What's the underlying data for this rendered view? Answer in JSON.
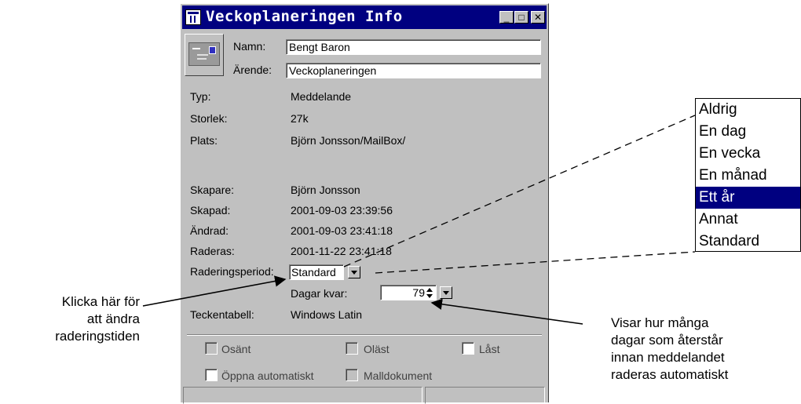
{
  "window": {
    "title": "Veckoplaneringen Info",
    "minimize_glyph": "_",
    "maximize_glyph": "□",
    "close_glyph": "✕"
  },
  "header": {
    "icon": "envelope-message-icon",
    "name_label": "Namn:",
    "name_value": "Bengt Baron",
    "subject_label": "Ärende:",
    "subject_value": "Veckoplaneringen"
  },
  "props": {
    "type_label": "Typ:",
    "type_value": "Meddelande",
    "size_label": "Storlek:",
    "size_value": "27k",
    "location_label": "Plats:",
    "location_value": "Björn Jonsson/MailBox/",
    "creator_label": "Skapare:",
    "creator_value": "Björn Jonsson",
    "created_label": "Skapad:",
    "created_value": "2001-09-03 23:39:56",
    "modified_label": "Ändrad:",
    "modified_value": "2001-09-03 23:41:18",
    "delete_label": "Raderas:",
    "delete_value": "2001-11-22 23:41:18",
    "period_label": "Raderingsperiod:",
    "period_value": "Standard",
    "days_left_label": "Dagar kvar:",
    "days_left_value": "79",
    "charset_label": "Teckentabell:",
    "charset_value": "Windows Latin"
  },
  "flags": {
    "unsent": "Osänt",
    "unread": "Oläst",
    "locked": "Låst",
    "auto_open": "Öppna automatiskt",
    "template": "Malldokument"
  },
  "popup": {
    "options": [
      "Aldrig",
      "En dag",
      "En vecka",
      "En månad",
      "Ett år",
      "Annat",
      "Standard"
    ],
    "selected": "Ett år"
  },
  "annotations": {
    "left_line1": "Klicka här för",
    "left_line2": "att ändra",
    "left_line3": "raderingstiden",
    "right_line1": "Visar hur många",
    "right_line2": "dagar som återstår",
    "right_line3": "innan meddelandet",
    "right_line4": "raderas automatiskt"
  },
  "colors": {
    "titlebar": "#000080",
    "dialog_face": "#c0c0c0",
    "selection": "#000080"
  }
}
